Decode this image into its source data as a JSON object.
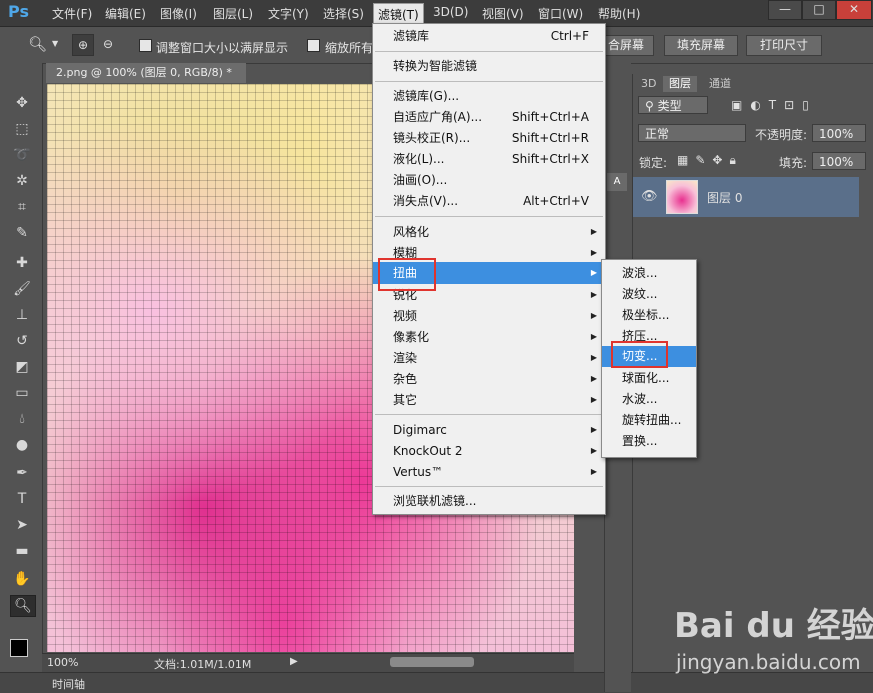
{
  "app": {
    "logo": "Ps"
  },
  "menubar": {
    "items": [
      "文件(F)",
      "编辑(E)",
      "图像(I)",
      "图层(L)",
      "文字(Y)",
      "选择(S)",
      "滤镜(T)",
      "3D(D)",
      "视图(V)",
      "窗口(W)",
      "帮助(H)"
    ],
    "active_index": 6,
    "window_buttons": [
      "—",
      "□",
      "✕"
    ]
  },
  "options": {
    "checkbox1": "调整窗口大小以满屏显示",
    "checkbox2": "缩放所有",
    "btn_fit": "合屏幕",
    "btn_fill": "填充屏幕",
    "btn_print": "打印尺寸"
  },
  "document": {
    "tab_title": "2.png @ 100% (图层 0, RGB/8) *",
    "tab_close": "×",
    "zoom": "100%",
    "doc_size": "文档:1.01M/1.01M"
  },
  "timeline": {
    "label": "时间轴"
  },
  "filter_menu": {
    "top": [
      {
        "label": "滤镜库",
        "shortcut": "Ctrl+F"
      }
    ],
    "group1": [
      {
        "label": "转换为智能滤镜"
      }
    ],
    "group2": [
      {
        "label": "滤镜库(G)..."
      },
      {
        "label": "自适应广角(A)...",
        "shortcut": "Shift+Ctrl+A"
      },
      {
        "label": "镜头校正(R)...",
        "shortcut": "Shift+Ctrl+R"
      },
      {
        "label": "液化(L)...",
        "shortcut": "Shift+Ctrl+X"
      },
      {
        "label": "油画(O)..."
      },
      {
        "label": "消失点(V)...",
        "shortcut": "Alt+Ctrl+V"
      }
    ],
    "group3": [
      {
        "label": "风格化"
      },
      {
        "label": "模糊"
      },
      {
        "label": "扭曲"
      },
      {
        "label": "锐化"
      },
      {
        "label": "视频"
      },
      {
        "label": "像素化"
      },
      {
        "label": "渲染"
      },
      {
        "label": "杂色"
      },
      {
        "label": "其它"
      }
    ],
    "group4": [
      {
        "label": "Digimarc"
      },
      {
        "label": "KnockOut 2"
      },
      {
        "label": "Vertus™"
      }
    ],
    "group5": [
      {
        "label": "浏览联机滤镜..."
      }
    ],
    "highlighted": "扭曲"
  },
  "distort_submenu": {
    "items": [
      "波浪...",
      "波纹...",
      "极坐标...",
      "挤压...",
      "切变...",
      "球面化...",
      "水波...",
      "旋转扭曲...",
      "置换..."
    ],
    "highlighted": "切变..."
  },
  "layers_panel": {
    "tabs": [
      "3D",
      "图层",
      "通道"
    ],
    "active_tab": "图层",
    "filter_kind": "类型",
    "blend_mode": "正常",
    "opacity_label": "不透明度:",
    "opacity": "100%",
    "lock_label": "锁定:",
    "fill_label": "填充:",
    "fill": "100%",
    "layer_name": "图层 0"
  },
  "watermark": {
    "brand": "Bai du 经验",
    "url": "jingyan.baidu.com"
  },
  "colors": {
    "highlight": "#3d8fe0",
    "annotation": "#e0342e"
  }
}
